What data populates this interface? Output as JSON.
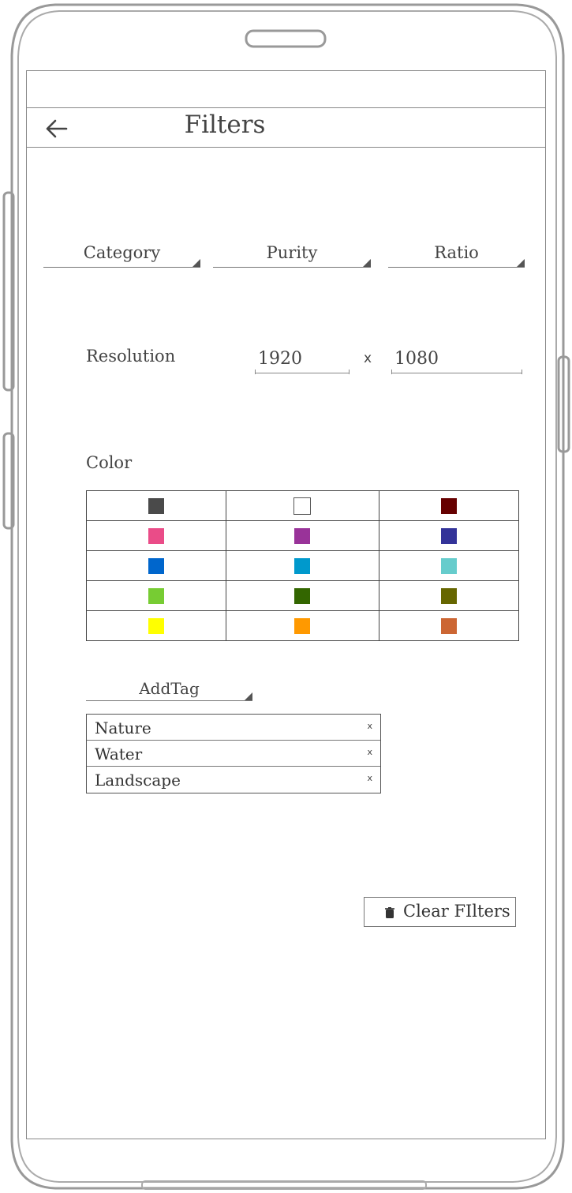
{
  "header": {
    "title": "Filters"
  },
  "dropdowns": [
    {
      "label": "Category"
    },
    {
      "label": "Purity"
    },
    {
      "label": "Ratio"
    }
  ],
  "resolution": {
    "label": "Resolution",
    "width": "1920",
    "separator": "x",
    "height": "1080"
  },
  "color_section": {
    "label": "Color",
    "swatches": [
      [
        "#4a4a4a",
        "#ffffff",
        "#660000"
      ],
      [
        "#ea4c88",
        "#993399",
        "#333399"
      ],
      [
        "#0066cc",
        "#0099cc",
        "#66cccc"
      ],
      [
        "#77cc33",
        "#336600",
        "#666600"
      ],
      [
        "#ffff00",
        "#ff9900",
        "#cc6633"
      ]
    ]
  },
  "tags": {
    "add_label": "AddTag",
    "items": [
      {
        "label": "Nature",
        "remove": "x"
      },
      {
        "label": "Water",
        "remove": "x"
      },
      {
        "label": "Landscape",
        "remove": "x"
      }
    ]
  },
  "actions": {
    "clear_label": "Clear FIlters"
  }
}
